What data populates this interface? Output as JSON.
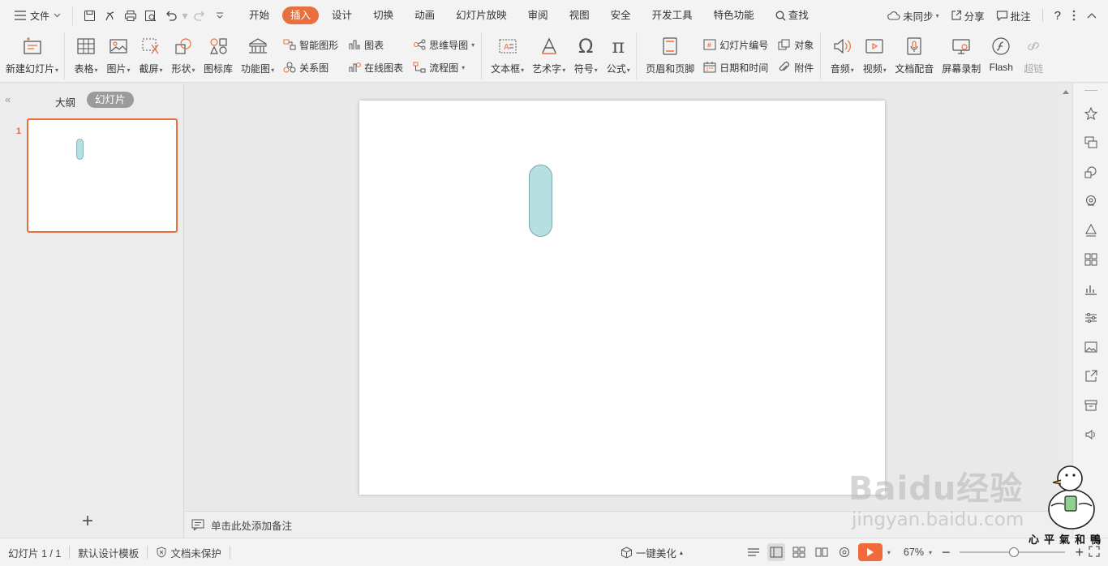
{
  "menubar": {
    "file_label": "文件",
    "tabs": [
      {
        "label": "开始",
        "active": false
      },
      {
        "label": "插入",
        "active": true
      },
      {
        "label": "设计",
        "active": false
      },
      {
        "label": "切换",
        "active": false
      },
      {
        "label": "动画",
        "active": false
      },
      {
        "label": "幻灯片放映",
        "active": false
      },
      {
        "label": "审阅",
        "active": false
      },
      {
        "label": "视图",
        "active": false
      },
      {
        "label": "安全",
        "active": false
      },
      {
        "label": "开发工具",
        "active": false
      },
      {
        "label": "特色功能",
        "active": false
      }
    ],
    "search_label": "查找",
    "sync_label": "未同步",
    "share_label": "分享",
    "comment_label": "批注",
    "help_label": "?",
    "accent_color": "#e8703f"
  },
  "ribbon": {
    "new_slide": "新建幻灯片",
    "table": "表格",
    "picture": "图片",
    "screenshot": "截屏",
    "shape": "形状",
    "icon_library": "图标库",
    "function_chart": "功能图",
    "smart_art": "智能图形",
    "chart": "图表",
    "relation": "关系图",
    "online_chart": "在线图表",
    "mind_map": "思维导图",
    "flow_chart": "流程图",
    "text_box": "文本框",
    "word_art": "艺术字",
    "symbol": "符号",
    "formula": "公式",
    "header_footer": "页眉和页脚",
    "slide_number": "幻灯片编号",
    "object": "对象",
    "date_time": "日期和时间",
    "attachment": "附件",
    "audio": "音频",
    "video": "视频",
    "doc_dub": "文档配音",
    "screen_record": "屏幕录制",
    "flash": "Flash",
    "hyperlink": "超链"
  },
  "left_panel": {
    "tab_outline": "大纲",
    "tab_slides": "幻灯片",
    "slide_number": "1",
    "add_icon": "+"
  },
  "canvas": {
    "shape_fill": "#b6dfe1",
    "shape_stroke": "#7fa9ab"
  },
  "notes": {
    "placeholder": "单击此处添加备注"
  },
  "statusbar": {
    "slide_info": "幻灯片 1 / 1",
    "template": "默认设计模板",
    "protection": "文档未保护",
    "beautify": "一键美化",
    "zoom": "67%",
    "zoom_fraction": 0.67
  },
  "watermark": {
    "logo": "Baidu经验",
    "url": "jingyan.baidu.com",
    "signature": "心平氣和鴨"
  }
}
